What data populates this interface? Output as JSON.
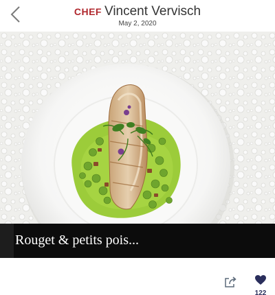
{
  "header": {
    "chef_prefix": "CHEF",
    "chef_name": "Vincent Vervisch",
    "date": "May 2, 2020",
    "back_icon": "chevron-left-icon"
  },
  "post": {
    "caption": "Rouget & petits pois...",
    "image_subject": "plated dish"
  },
  "actions": {
    "share_icon": "share-icon",
    "like_icon": "heart-icon",
    "like_count": "122"
  },
  "colors": {
    "brand_red": "#b0272d",
    "heart_navy": "#2a2e5c",
    "caption_bg": "#0c0c0c"
  }
}
